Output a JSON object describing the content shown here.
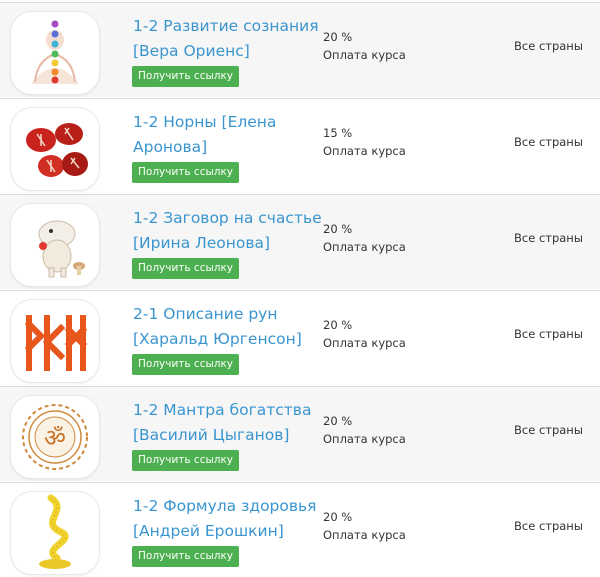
{
  "offers": [
    {
      "title": "1-2 Развитие сознания [Вера Ориенс]",
      "button": "Получить ссылку",
      "percent": "20 %",
      "payment": "Оплата курса",
      "country": "Все страны",
      "icon": "chakra-meditation-icon"
    },
    {
      "title": "1-2 Норны [Елена Аронова]",
      "button": "Получить ссылку",
      "percent": "15 %",
      "payment": "Оплата курса",
      "country": "Все страны",
      "icon": "rune-stones-icon"
    },
    {
      "title": "1-2 Заговор на счастье [Ирина Леонова]",
      "button": "Получить ссылку",
      "percent": "20 %",
      "payment": "Оплата курса",
      "country": "Все страны",
      "icon": "moomin-icon"
    },
    {
      "title": "2-1 Описание рун [Харальд Юргенсон]",
      "button": "Получить ссылку",
      "percent": "20 %",
      "payment": "Оплата курса",
      "country": "Все страны",
      "icon": "rune-symbols-icon"
    },
    {
      "title": "1-2 Мантра богатства [Василий Цыганов]",
      "button": "Получить ссылку",
      "percent": "20 %",
      "payment": "Оплата курса",
      "country": "Все страны",
      "icon": "om-mandala-icon"
    },
    {
      "title": "1-2 Формула здоровья [Андрей Ерошкин]",
      "button": "Получить ссылку",
      "percent": "20 %",
      "payment": "Оплата курса",
      "country": "Все страны",
      "icon": "measuring-tape-icon"
    }
  ],
  "colors": {
    "link": "#3a95cf",
    "button": "#4caf50",
    "row_alt": "#f6f6f6"
  }
}
